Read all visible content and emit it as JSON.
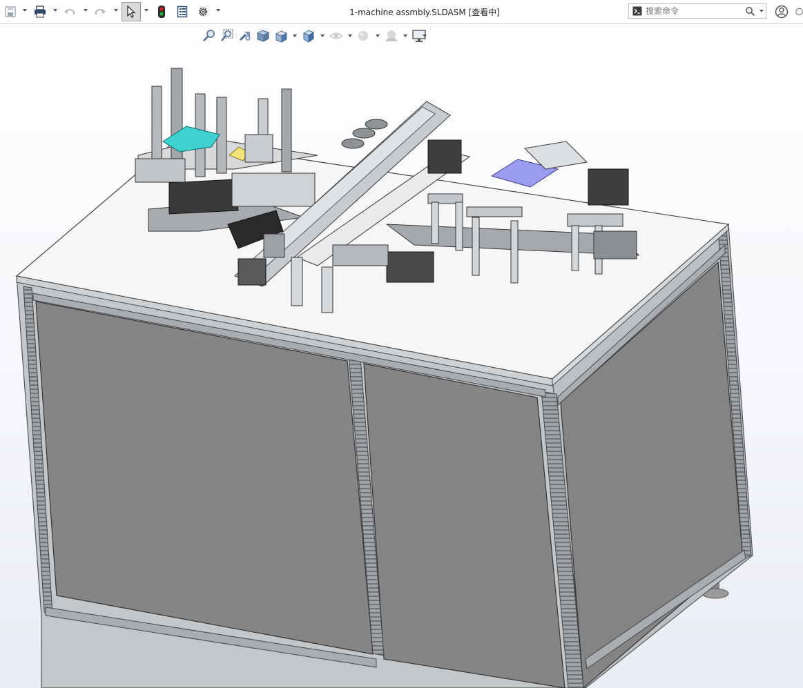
{
  "window": {
    "title": "1-machine assmbly.SLDASM [查看中]"
  },
  "search": {
    "placeholder": "搜索命令"
  },
  "toolbar": {
    "buttons": [
      "save",
      "print",
      "undo",
      "redo",
      "select",
      "rebuild",
      "file-properties",
      "options"
    ]
  },
  "heads_up_toolbar": {
    "buttons": [
      "zoom-to-fit",
      "zoom-to-area",
      "previous-view",
      "section-view",
      "view-orientation",
      "display-style",
      "hide-show-items",
      "edit-appearance",
      "apply-scene",
      "view-settings"
    ]
  },
  "colors": {
    "frame": "#b8bcc0",
    "panel": "#858585",
    "tabletop": "#f6f6f6",
    "highlight_cyan": "#3fd0d0",
    "highlight_yellow": "#f1e27a",
    "highlight_violet": "#9b9bf0"
  }
}
